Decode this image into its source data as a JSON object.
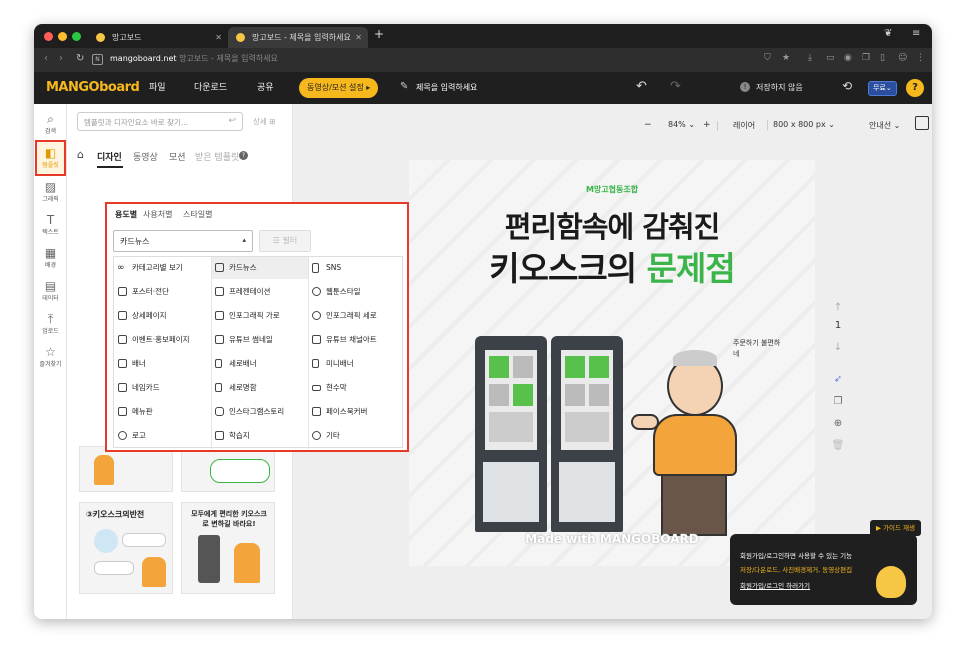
{
  "browser": {
    "tabs": [
      {
        "label": "망고보드"
      },
      {
        "label": "망고보드 - 제목을 입력하세요"
      }
    ],
    "new_tab": "+",
    "url": "mangoboard.net",
    "url_suffix": "망고보드 - 제목을 입력하세요"
  },
  "app": {
    "logo": "MANGOboard",
    "menu": [
      "파일",
      "다운로드",
      "공유"
    ],
    "motion_button": "동영상/모션 설정 ▸",
    "title_placeholder": "제목을 입력하세요",
    "save_status": "저장하지 않음",
    "plan_badge": "무료⌄",
    "help": "?"
  },
  "sidebar": {
    "items": [
      {
        "label": "검색",
        "icon": "search-icon"
      },
      {
        "label": "템플릿",
        "icon": "template-icon"
      },
      {
        "label": "그래픽",
        "icon": "graphic-icon"
      },
      {
        "label": "텍스트",
        "icon": "text-icon"
      },
      {
        "label": "배경",
        "icon": "background-icon"
      },
      {
        "label": "데이터",
        "icon": "chart-icon"
      },
      {
        "label": "업로드",
        "icon": "upload-icon"
      },
      {
        "label": "즐겨찾기",
        "icon": "star-icon"
      }
    ]
  },
  "panel": {
    "search_placeholder": "템플릿과 디자인요소 바로 찾기...",
    "detail": "상세",
    "tabs": [
      "디자인",
      "동영상",
      "모션",
      "받은 템플릿"
    ],
    "subtabs": [
      "용도별",
      "사용처별",
      "스타일별"
    ],
    "select_value": "카드뉴스",
    "filter": "필터",
    "options": [
      [
        "카테고리별 보기",
        "카드뉴스",
        "SNS"
      ],
      [
        "포스터·전단",
        "프레젠테이션",
        "웹툰스타일"
      ],
      [
        "상세페이지",
        "인포그래픽 가로",
        "인포그래픽 세로"
      ],
      [
        "이벤트·홍보페이지",
        "유튜브 썸네일",
        "유튜브 채널아트"
      ],
      [
        "배너",
        "세로배너",
        "미니배너"
      ],
      [
        "네임카드",
        "세로명함",
        "현수막"
      ],
      [
        "메뉴판",
        "인스타그램스토리",
        "페이스북커버"
      ],
      [
        "로고",
        "학습지",
        "기타"
      ]
    ],
    "thumb_texts": [
      "③키오스크의반전",
      "모두에게 편리한 키오스크로 변하길 바라요!"
    ]
  },
  "toolbar": {
    "zoom_minus": "−",
    "zoom": "84%",
    "zoom_plus": "+",
    "layer": "레이어",
    "size": "800 x 800 px",
    "guide": "안내선"
  },
  "canvas": {
    "org": "M망고협동조합",
    "headline1": "편리함속에 감춰진",
    "headline2a": "키오스크의 ",
    "headline2b": "문제점",
    "speech": "주문하기 불편하네",
    "watermark": "Made with MANGOBOARD",
    "page_number": "1"
  },
  "promo": {
    "badge": "▶ 가이드 재생",
    "line1": "회원가입/로그인하면 사용할 수 있는 기능",
    "line2": "저장/다운로드, 사진배경제거, 동영상편집",
    "link": "회원가입/로그인 하러가기"
  },
  "colors": {
    "accent": "#f6b81c",
    "highlight": "#e53a2a",
    "green": "#3bb54a"
  }
}
